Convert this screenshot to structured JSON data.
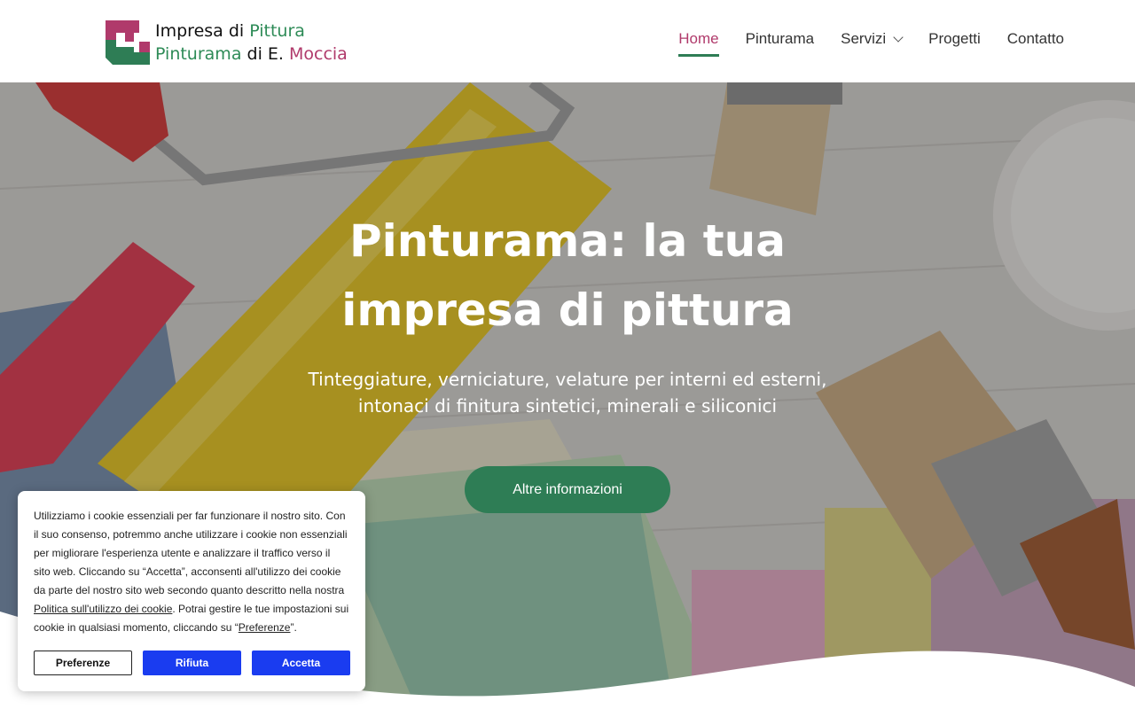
{
  "header": {
    "logo": {
      "line1_a": "Impresa di ",
      "line1_b": "Pittura",
      "line2_a": "Pinturama",
      "line2_b": " di E. ",
      "line2_c": "Moccia"
    },
    "nav": [
      {
        "label": "Home",
        "active": true
      },
      {
        "label": "Pinturama"
      },
      {
        "label": "Servizi",
        "has_dropdown": true
      },
      {
        "label": "Progetti"
      },
      {
        "label": "Contatto"
      }
    ]
  },
  "hero": {
    "title_line1": "Pinturama: la tua",
    "title_line2": "impresa di pittura",
    "subtitle_line1": "Tinteggiature, verniciature, velature per interni ed esterni,",
    "subtitle_line2": "intonaci di finitura sintetici, minerali e siliconici",
    "button_label": "Altre informazioni"
  },
  "cookie": {
    "text_part1": "Utilizziamo i cookie essenziali per far funzionare il nostro sito. Con il suo consenso, potremmo anche utilizzare i cookie non essenziali per migliorare l'esperienza utente e analizzare il traffico verso il sito web. Cliccando su “Accetta”, acconsenti all'utilizzo dei cookie da parte del nostro sito web secondo quanto descritto nella nostra ",
    "policy_link": "Politica sull'utilizzo dei cookie",
    "text_part2": ". Potrai gestire le tue impostazioni sui cookie in qualsiasi momento, cliccando su “",
    "pref_link": "Preferenze",
    "text_part3": "”.",
    "buttons": {
      "preferences": "Preferenze",
      "reject": "Rifiuta",
      "accept": "Accetta"
    }
  },
  "colors": {
    "brand_green": "#2e7d55",
    "brand_pink": "#b03a6b",
    "cookie_blue": "#1a3cf0"
  }
}
